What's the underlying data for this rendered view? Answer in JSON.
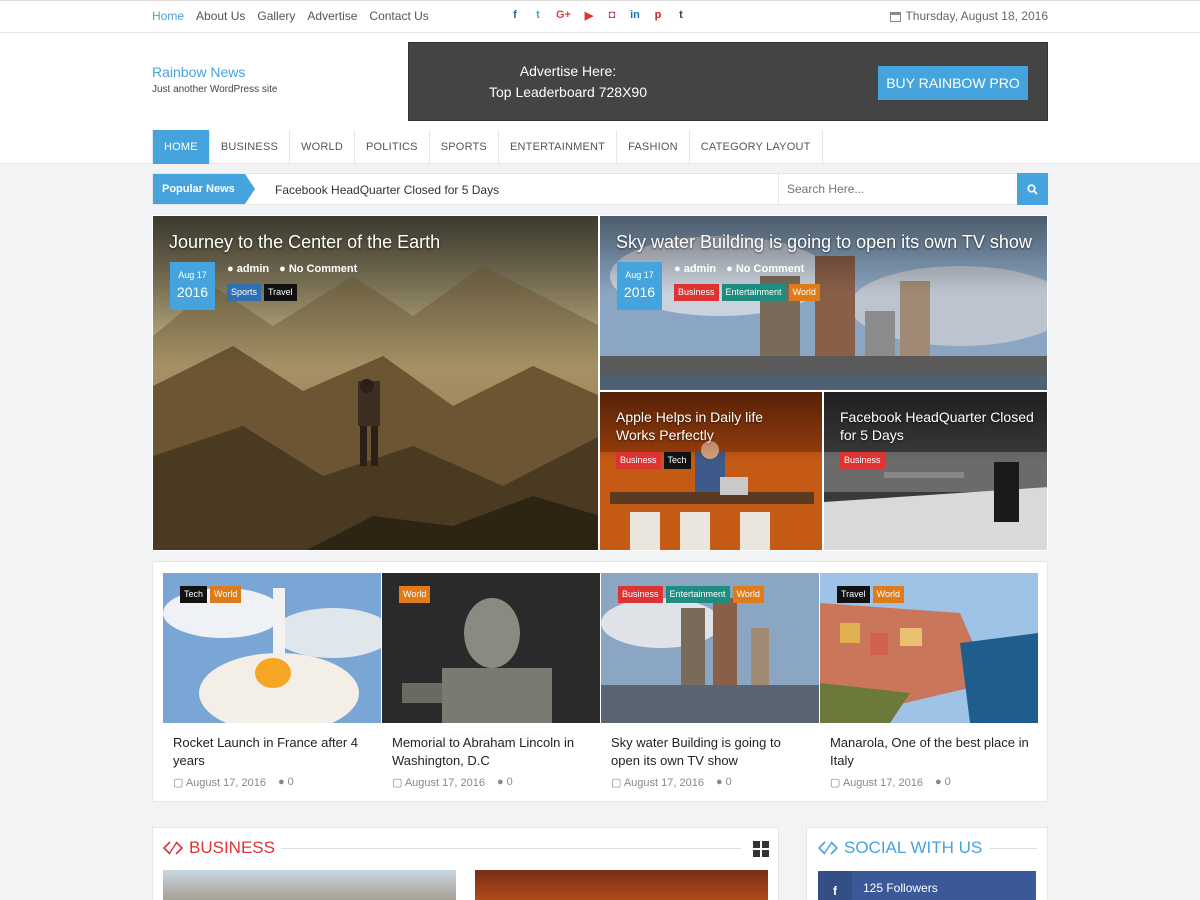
{
  "topbar": {
    "links": [
      "Home",
      "About Us",
      "Gallery",
      "Advertise",
      "Contact Us"
    ],
    "socials": [
      "facebook-icon",
      "twitter-icon",
      "google-plus-icon",
      "youtube-icon",
      "instagram-icon",
      "linkedin-icon",
      "pinterest-icon",
      "tumblr-icon"
    ],
    "social_glyphs": [
      "f",
      "t",
      "G+",
      "▶",
      "◘",
      "in",
      "p",
      "t"
    ],
    "date": "Thursday, August 18, 2016"
  },
  "header": {
    "site_title": "Rainbow News",
    "tagline": "Just another WordPress site",
    "ad_line1": "Advertise Here:",
    "ad_line2": "Top Leaderboard 728X90",
    "ad_button": "BUY RAINBOW PRO"
  },
  "nav": {
    "items": [
      "HOME",
      "BUSINESS",
      "WORLD",
      "POLITICS",
      "SPORTS",
      "ENTERTAINMENT",
      "FASHION",
      "CATEGORY LAYOUT"
    ]
  },
  "ticker": {
    "label": "Popular News",
    "text": "Facebook HeadQuarter Closed for 5 Days"
  },
  "search": {
    "placeholder": "Search Here..."
  },
  "featured": {
    "big": {
      "title": "Journey to the Center of the Earth",
      "month_day": "Aug 17",
      "year": "2016",
      "author": "admin",
      "comments": "No Comment",
      "tags": [
        "Sports",
        "Travel"
      ]
    },
    "top_right": {
      "title": "Sky water Building is going to open its own TV show",
      "month_day": "Aug 17",
      "year": "2016",
      "author": "admin",
      "comments": "No Comment",
      "tags": [
        "Business",
        "Entertainment",
        "World"
      ]
    },
    "small1": {
      "title": "Apple Helps in Daily life Works Perfectly",
      "tags": [
        "Business",
        "Tech"
      ]
    },
    "small2": {
      "title": "Facebook HeadQuarter Closed for 5 Days",
      "tags": [
        "Business"
      ]
    }
  },
  "cards": [
    {
      "title": "Rocket Launch in France after 4 years",
      "date": "August 17, 2016",
      "comments": "0",
      "tags": [
        "Tech",
        "World"
      ]
    },
    {
      "title": "Memorial to Abraham Lincoln in Washington, D.C",
      "date": "August 17, 2016",
      "comments": "0",
      "tags": [
        "World"
      ]
    },
    {
      "title": "Sky water Building is going to open its own TV show",
      "date": "August 17, 2016",
      "comments": "0",
      "tags": [
        "Business",
        "Entertainment",
        "World"
      ]
    },
    {
      "title": "Manarola, One of the best place in Italy",
      "date": "August 17, 2016",
      "comments": "0",
      "tags": [
        "Travel",
        "World"
      ]
    }
  ],
  "business_section": {
    "title": "BUSINESS"
  },
  "social_section": {
    "title": "SOCIAL WITH US",
    "facebook_followers": "125 Followers"
  },
  "colors": {
    "accent": "#45a3dd",
    "business_tag": "#dd3333",
    "entertainment_tag": "#1e8c7e",
    "world_tag": "#e07b1a",
    "sports_tag": "#2f6fb5",
    "travel_tag": "#111111",
    "tech_tag": "#111111",
    "section_red": "#dd3333"
  }
}
